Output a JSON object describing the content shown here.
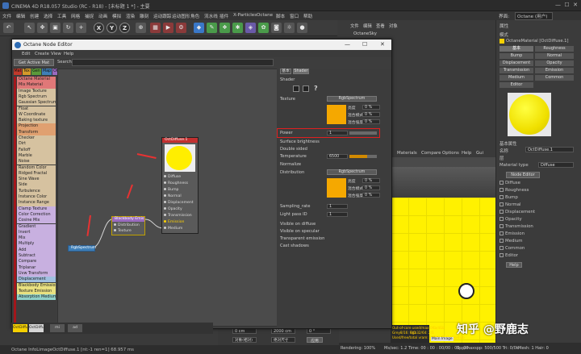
{
  "window_title": "CINEMA 4D R18.057 Studio (RC - R18) - [未标题 1 *] - 主要",
  "menu": [
    "文件",
    "编辑",
    "创建",
    "选择",
    "工具",
    "网格",
    "捕捉",
    "动画",
    "模拟",
    "渲染",
    "雕刻",
    "运动跟踪",
    "运动图形",
    "角色",
    "流水线",
    "插件",
    "X-Particles",
    "Octane",
    "脚本",
    "窗口",
    "帮助"
  ],
  "layout_label": "界面:",
  "layout_value": "Octane (用户)",
  "node_editor": {
    "title": "Octane Node Editor",
    "menu": [
      "Edit",
      "Create",
      "View",
      "Help"
    ],
    "get_active_mat": "Get Active Mat",
    "search_label": "Search",
    "category_tabs": [
      {
        "label": "Mat",
        "color": "#c0392b"
      },
      {
        "label": "Tex",
        "color": "#d49a2a"
      },
      {
        "label": "Gen",
        "color": "#5b9a3a"
      },
      {
        "label": "Map",
        "color": "#3e7fb8"
      },
      {
        "label": "Oth",
        "color": "#9a6ac0"
      },
      {
        "label": "Ems",
        "color": "#d8d040"
      },
      {
        "label": "Med",
        "color": "#5ac0b0"
      },
      {
        "label": "OBJ",
        "color": "#9a9a9a"
      }
    ],
    "node_list": [
      {
        "label": "Octane Material",
        "color": "#e07878"
      },
      {
        "label": "Mix Material",
        "color": "#e07878"
      },
      {
        "label": "Image Texture",
        "color": "#d6c2a0"
      },
      {
        "label": "Rgb Spectrum",
        "color": "#d6c2a0"
      },
      {
        "label": "Gaussian Spectrum",
        "color": "#d6c2a0"
      },
      {
        "label": "Float",
        "color": "#d6c2a0"
      },
      {
        "label": "W Coordinate",
        "color": "#d6c2a0"
      },
      {
        "label": "Baking texture",
        "color": "#d6c2a0"
      },
      {
        "label": "Projection",
        "color": "#e0a070"
      },
      {
        "label": "Transform",
        "color": "#e0a070"
      },
      {
        "label": "Checker",
        "color": "#d6c2a0"
      },
      {
        "label": "Dirt",
        "color": "#d6c2a0"
      },
      {
        "label": "Falloff",
        "color": "#d6c2a0"
      },
      {
        "label": "Marble",
        "color": "#d6c2a0"
      },
      {
        "label": "Noise",
        "color": "#d6c2a0"
      },
      {
        "label": "Random Color",
        "color": "#d6c2a0"
      },
      {
        "label": "Ridged Fractal",
        "color": "#d6c2a0"
      },
      {
        "label": "Sine Wave",
        "color": "#d6c2a0"
      },
      {
        "label": "Side",
        "color": "#d6c2a0"
      },
      {
        "label": "Turbulence",
        "color": "#d6c2a0"
      },
      {
        "label": "Instance Color",
        "color": "#d6c2a0"
      },
      {
        "label": "Instance Range",
        "color": "#d6c2a0"
      },
      {
        "label": "Clamp Texture",
        "color": "#c8b0e0"
      },
      {
        "label": "Color Correction",
        "color": "#c8b0e0"
      },
      {
        "label": "Cosine Mix",
        "color": "#c8b0e0"
      },
      {
        "label": "Gradient",
        "color": "#c8b0e0"
      },
      {
        "label": "Invert",
        "color": "#c8b0e0"
      },
      {
        "label": "Mix",
        "color": "#c8b0e0"
      },
      {
        "label": "Multiply",
        "color": "#c8b0e0"
      },
      {
        "label": "Add",
        "color": "#c8b0e0"
      },
      {
        "label": "Subtract",
        "color": "#c8b0e0"
      },
      {
        "label": "Compare",
        "color": "#c8b0e0"
      },
      {
        "label": "Triplanar",
        "color": "#c8b0e0"
      },
      {
        "label": "Uvw Transform",
        "color": "#c8b0e0"
      },
      {
        "label": "Displacement",
        "color": "#a0c0e0"
      },
      {
        "label": "Blackbody Emission",
        "color": "#e8e080"
      },
      {
        "label": "Texture Emission",
        "color": "#e8e080"
      },
      {
        "label": "Absorption Medium",
        "color": "#90d0c8"
      }
    ],
    "nodes": {
      "main": {
        "title": "OctDiffuse.1",
        "pins": [
          "Diffuse",
          "Roughness",
          "Bump",
          "Normal",
          "Displacement",
          "Opacity",
          "Transmission",
          "Emission",
          "Medium"
        ]
      },
      "blackbody": {
        "title": "Blackbody Emis",
        "pins": [
          "Distribution",
          "Texture"
        ]
      },
      "rgb": {
        "title": "RgbSpectrum"
      }
    },
    "bottom_tabs": [
      "OctDiffu",
      "OctDiffu",
      "mi",
      "ad"
    ],
    "status": "Octane InfoLimageOctDiffuse.1 [nt:-1 ren=1]  68.957 ms"
  },
  "shader_props": {
    "tabs": [
      "基本",
      "Shader"
    ],
    "section": "Shader",
    "texture_label": "Texture",
    "texture_value": "RgbSpectrum",
    "sub_labels": [
      "亮度",
      "混合模式",
      "混合强度"
    ],
    "sub_values": [
      "0 %",
      "0 %",
      "0 %"
    ],
    "power_label": "Power",
    "power_value": "1",
    "surface_brightness": "Surface brightness",
    "double_sided": "Double sided",
    "temperature_label": "Temperature",
    "temperature_value": "6500",
    "normalize": "Normalize",
    "distribution_label": "Distribution",
    "distribution_value": "RgbSpectrum",
    "sampling_rate_label": "Sampling_rate",
    "sampling_rate_value": "1",
    "light_pass_id_label": "Light pass ID",
    "light_pass_id_value": "1",
    "visible_diffuse": "Visible on diffuse",
    "visible_specular": "Visible on specular",
    "transparent_emission": "Transparent emission",
    "cast_shadows": "Cast shadows"
  },
  "viewport": {
    "menu": [
      "Materials",
      "Compare",
      "Options",
      "Help",
      "Gui"
    ],
    "status": [
      "Out-of-core used/max:0Kb/4Gb",
      "Grey8/16: 0/0",
      "Rgb32/64: 2/1",
      "Used/free/total vram: 912Mb/2.414Gb/4Gb",
      "Main Image",
      "Rendering: 100%",
      "Ms/sec: 1.2  Time: 00 : 00 : 00/00 : 00 : 00",
      "Spp/maxspp: 500/500  Tri: 0/0k",
      "Mesh: 1  Hair: 0"
    ]
  },
  "attributes": {
    "title": "属性",
    "mode_label": "模式",
    "material_name": "OctaneMaterial [OctDiffuse.1]",
    "tabs": [
      "基本",
      "Roughness",
      "Bump",
      "Normal",
      "Displacement",
      "Opacity",
      "Transmission",
      "Emission",
      "Medium",
      "Common",
      "Editor"
    ],
    "basic_props_title": "基本属性",
    "name_label": "名称",
    "name_value": "OctDiffuse.1",
    "layer_label": "层",
    "material_type_label": "Material type",
    "material_type_value": "Diffuse",
    "node_editor_btn": "Node Editor",
    "channels": [
      "Diffuse",
      "Roughness",
      "Bump",
      "Normal",
      "Displacement",
      "Opacity",
      "Transmission",
      "Emission",
      "Medium",
      "Common",
      "Editor"
    ],
    "help_btn": "Help"
  },
  "timeline": {
    "frame_a": "0 cm",
    "frame_b": "2000 cm",
    "frame_c": "0 °",
    "btn": "应用",
    "mode1": "对象(相对)",
    "mode2": "绝对尺寸"
  },
  "objpanel": {
    "menu": [
      "文件",
      "编辑",
      "查看",
      "对象"
    ],
    "obj": "OctaneSky"
  },
  "watermark": "知乎 @野鹿志"
}
